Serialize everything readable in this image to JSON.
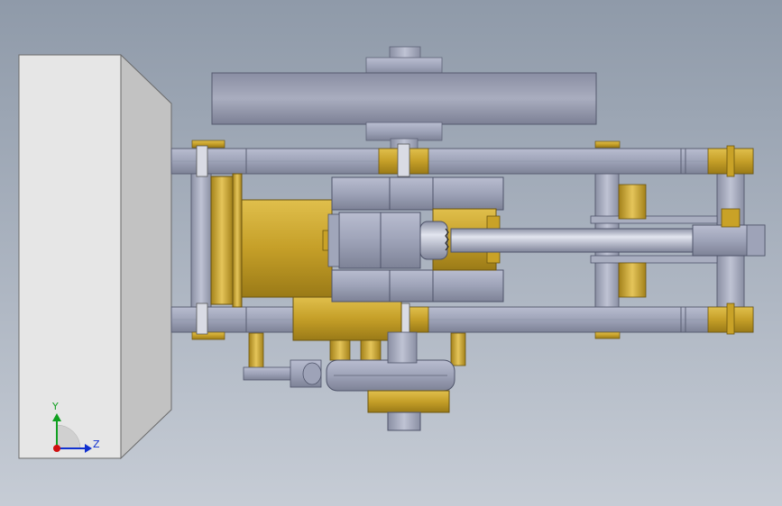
{
  "colors": {
    "steel": "#a2a8bc",
    "steel_dark": "#6f7488",
    "steel_light": "#c9cddb",
    "brass": "#c9a227",
    "brass_dark": "#8a6c12",
    "brass_light": "#e3c45a",
    "block_front": "#e6e6e6",
    "block_side": "#c4c4c4",
    "axis_x": "#d01010",
    "axis_y": "#10a020",
    "axis_z": "#1030d0"
  },
  "triad": {
    "y_label": "Y",
    "z_label": "Z"
  }
}
